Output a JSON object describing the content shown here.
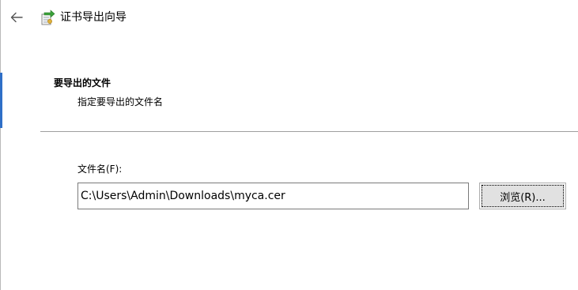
{
  "window": {
    "title": "证书导出向导",
    "back_icon": "back-arrow-icon",
    "title_icon": "certificate-wizard-icon"
  },
  "section": {
    "heading": "要导出的文件",
    "subheading": "指定要导出的文件名"
  },
  "file_field": {
    "label": "文件名(F):",
    "value": "C:\\Users\\Admin\\Downloads\\myca.cer"
  },
  "browse_button": {
    "label": "浏览(R)..."
  },
  "colors": {
    "accent": "#2f6fc7",
    "button_bg": "#e1e1e1",
    "divider": "#9f9f9f"
  }
}
